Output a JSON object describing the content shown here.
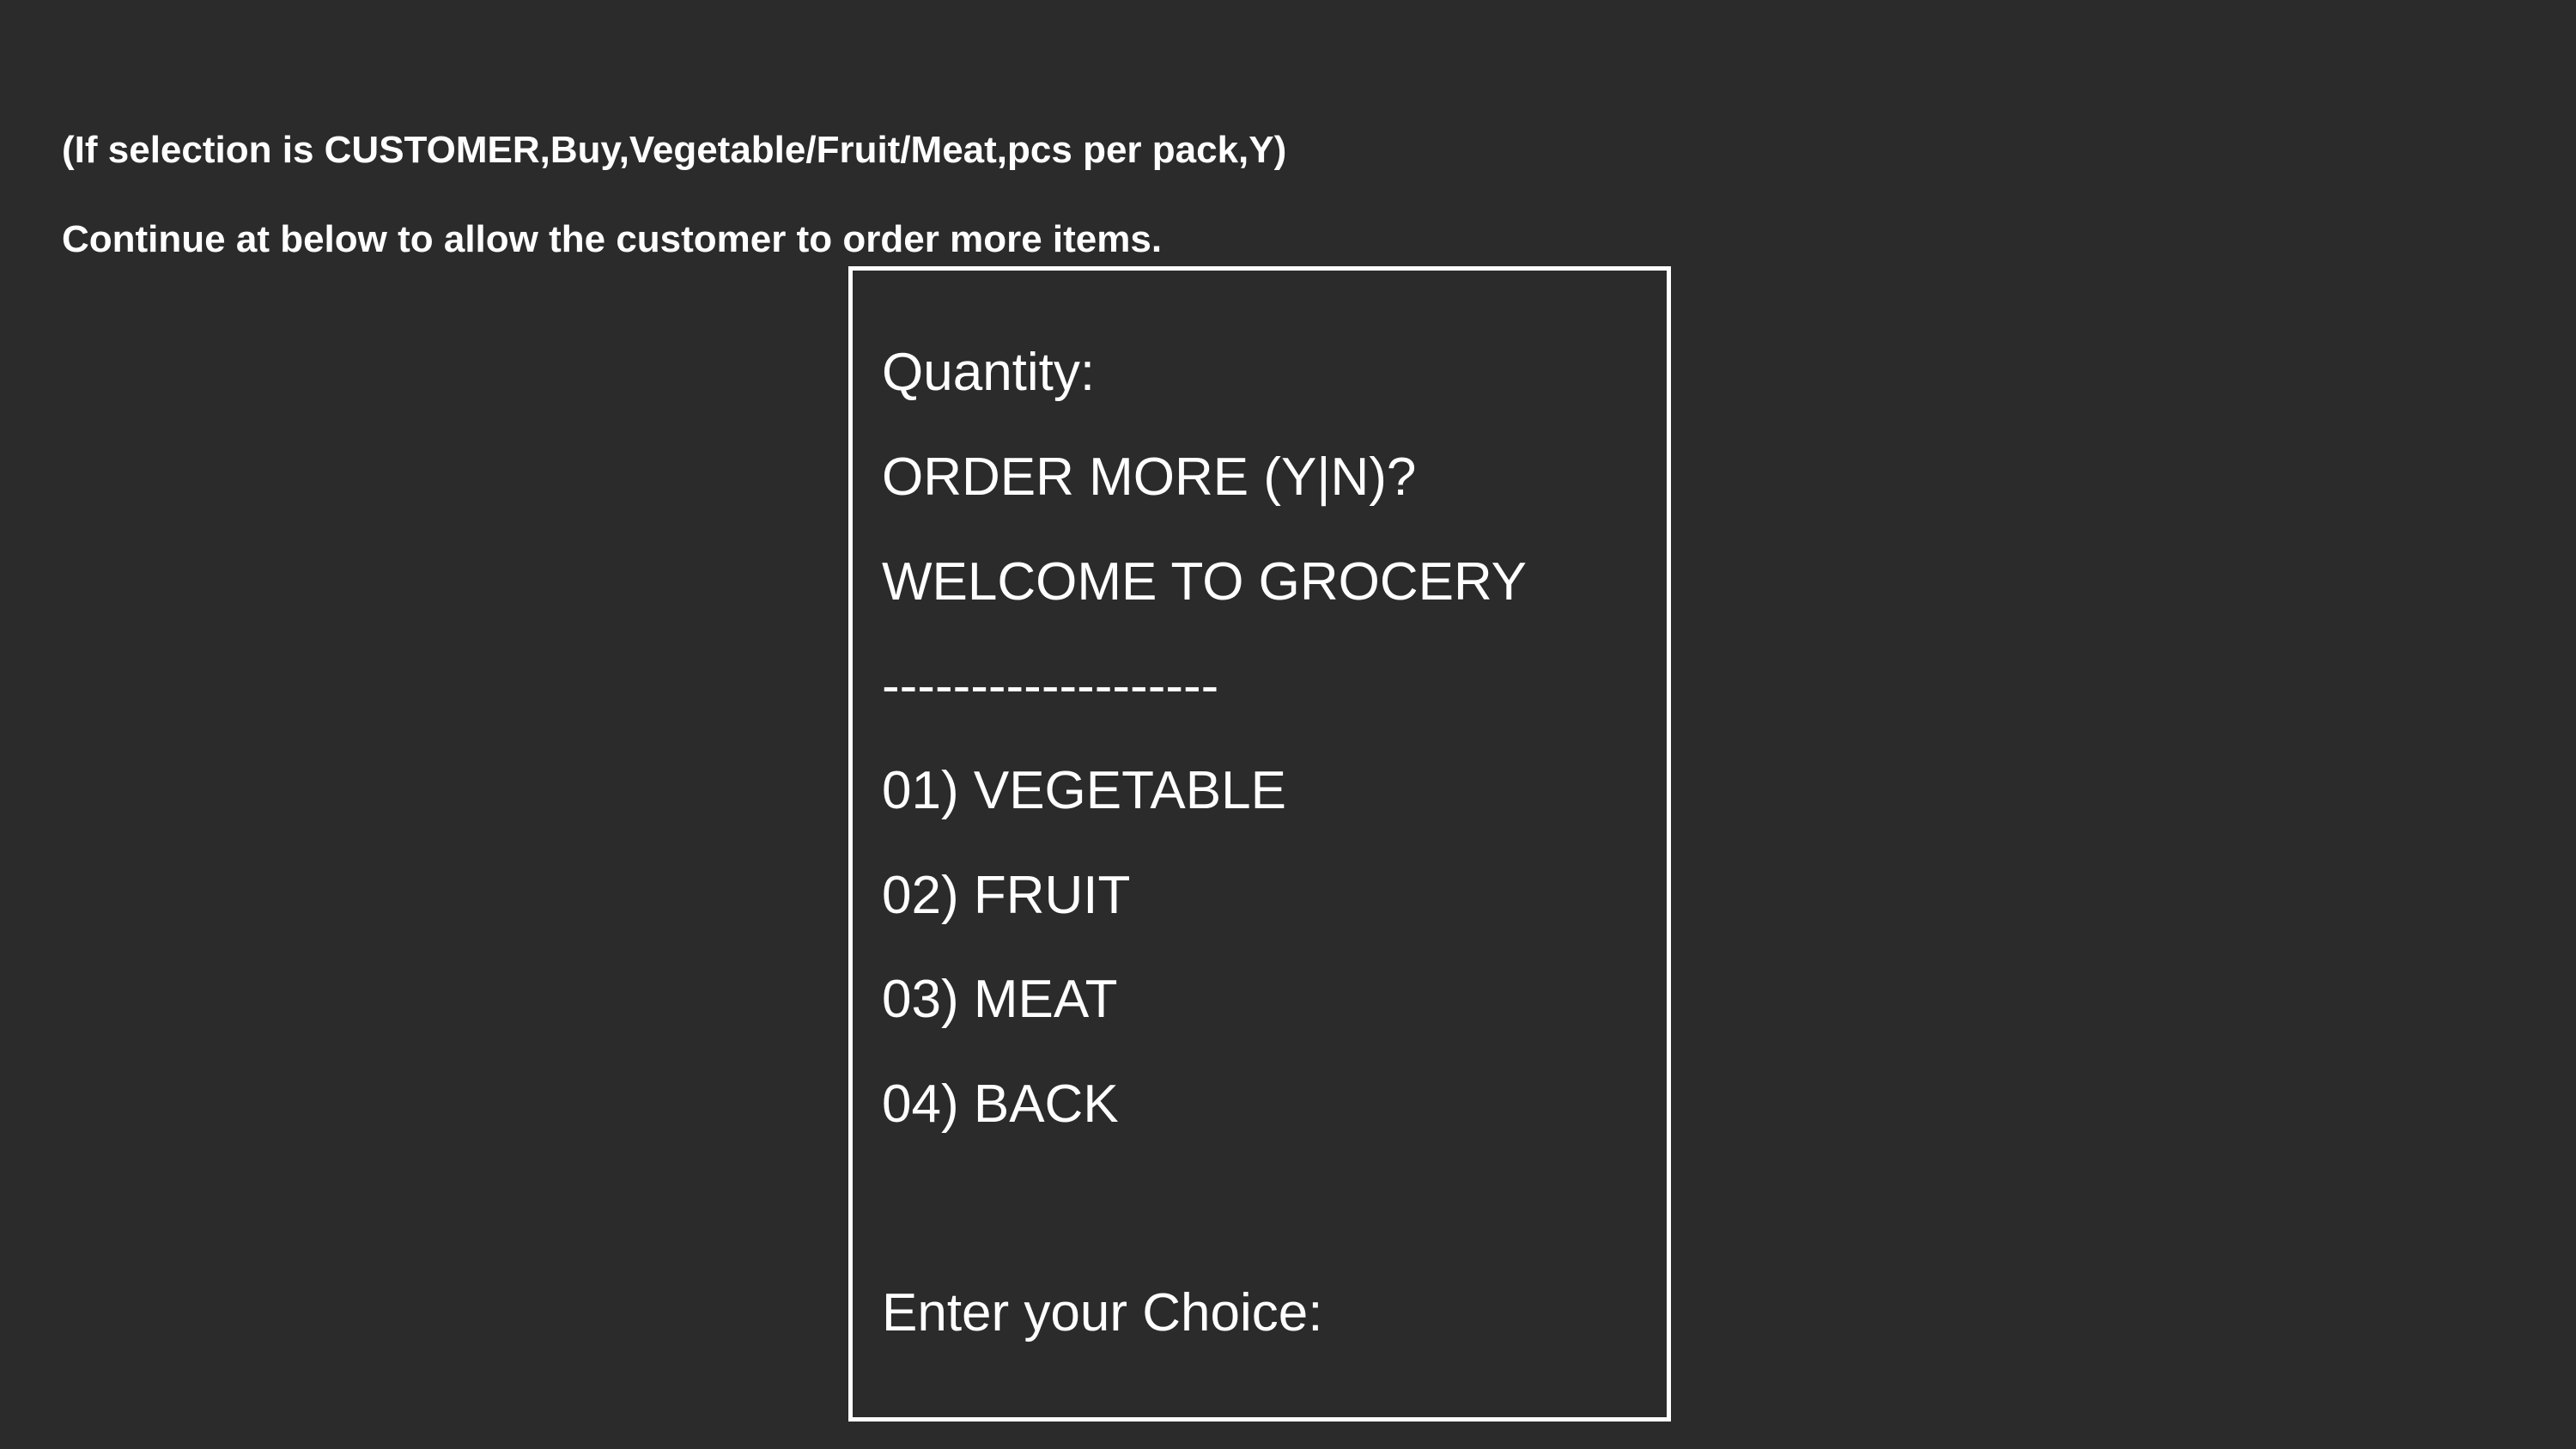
{
  "intro": {
    "line1": "(If selection is CUSTOMER,Buy,Vegetable/Fruit/Meat,pcs per pack,Y)",
    "line2": "Continue at below to allow the customer to order more items."
  },
  "console": {
    "quantity_prompt": "Quantity:",
    "order_more_prompt": "ORDER MORE (Y|N)?",
    "welcome_title": "WELCOME TO GROCERY",
    "separator": "-------------------",
    "menu_items": [
      "01) VEGETABLE",
      "02) FRUIT",
      "03) MEAT",
      "04) BACK"
    ],
    "choice_prompt": "Enter your Choice:"
  }
}
